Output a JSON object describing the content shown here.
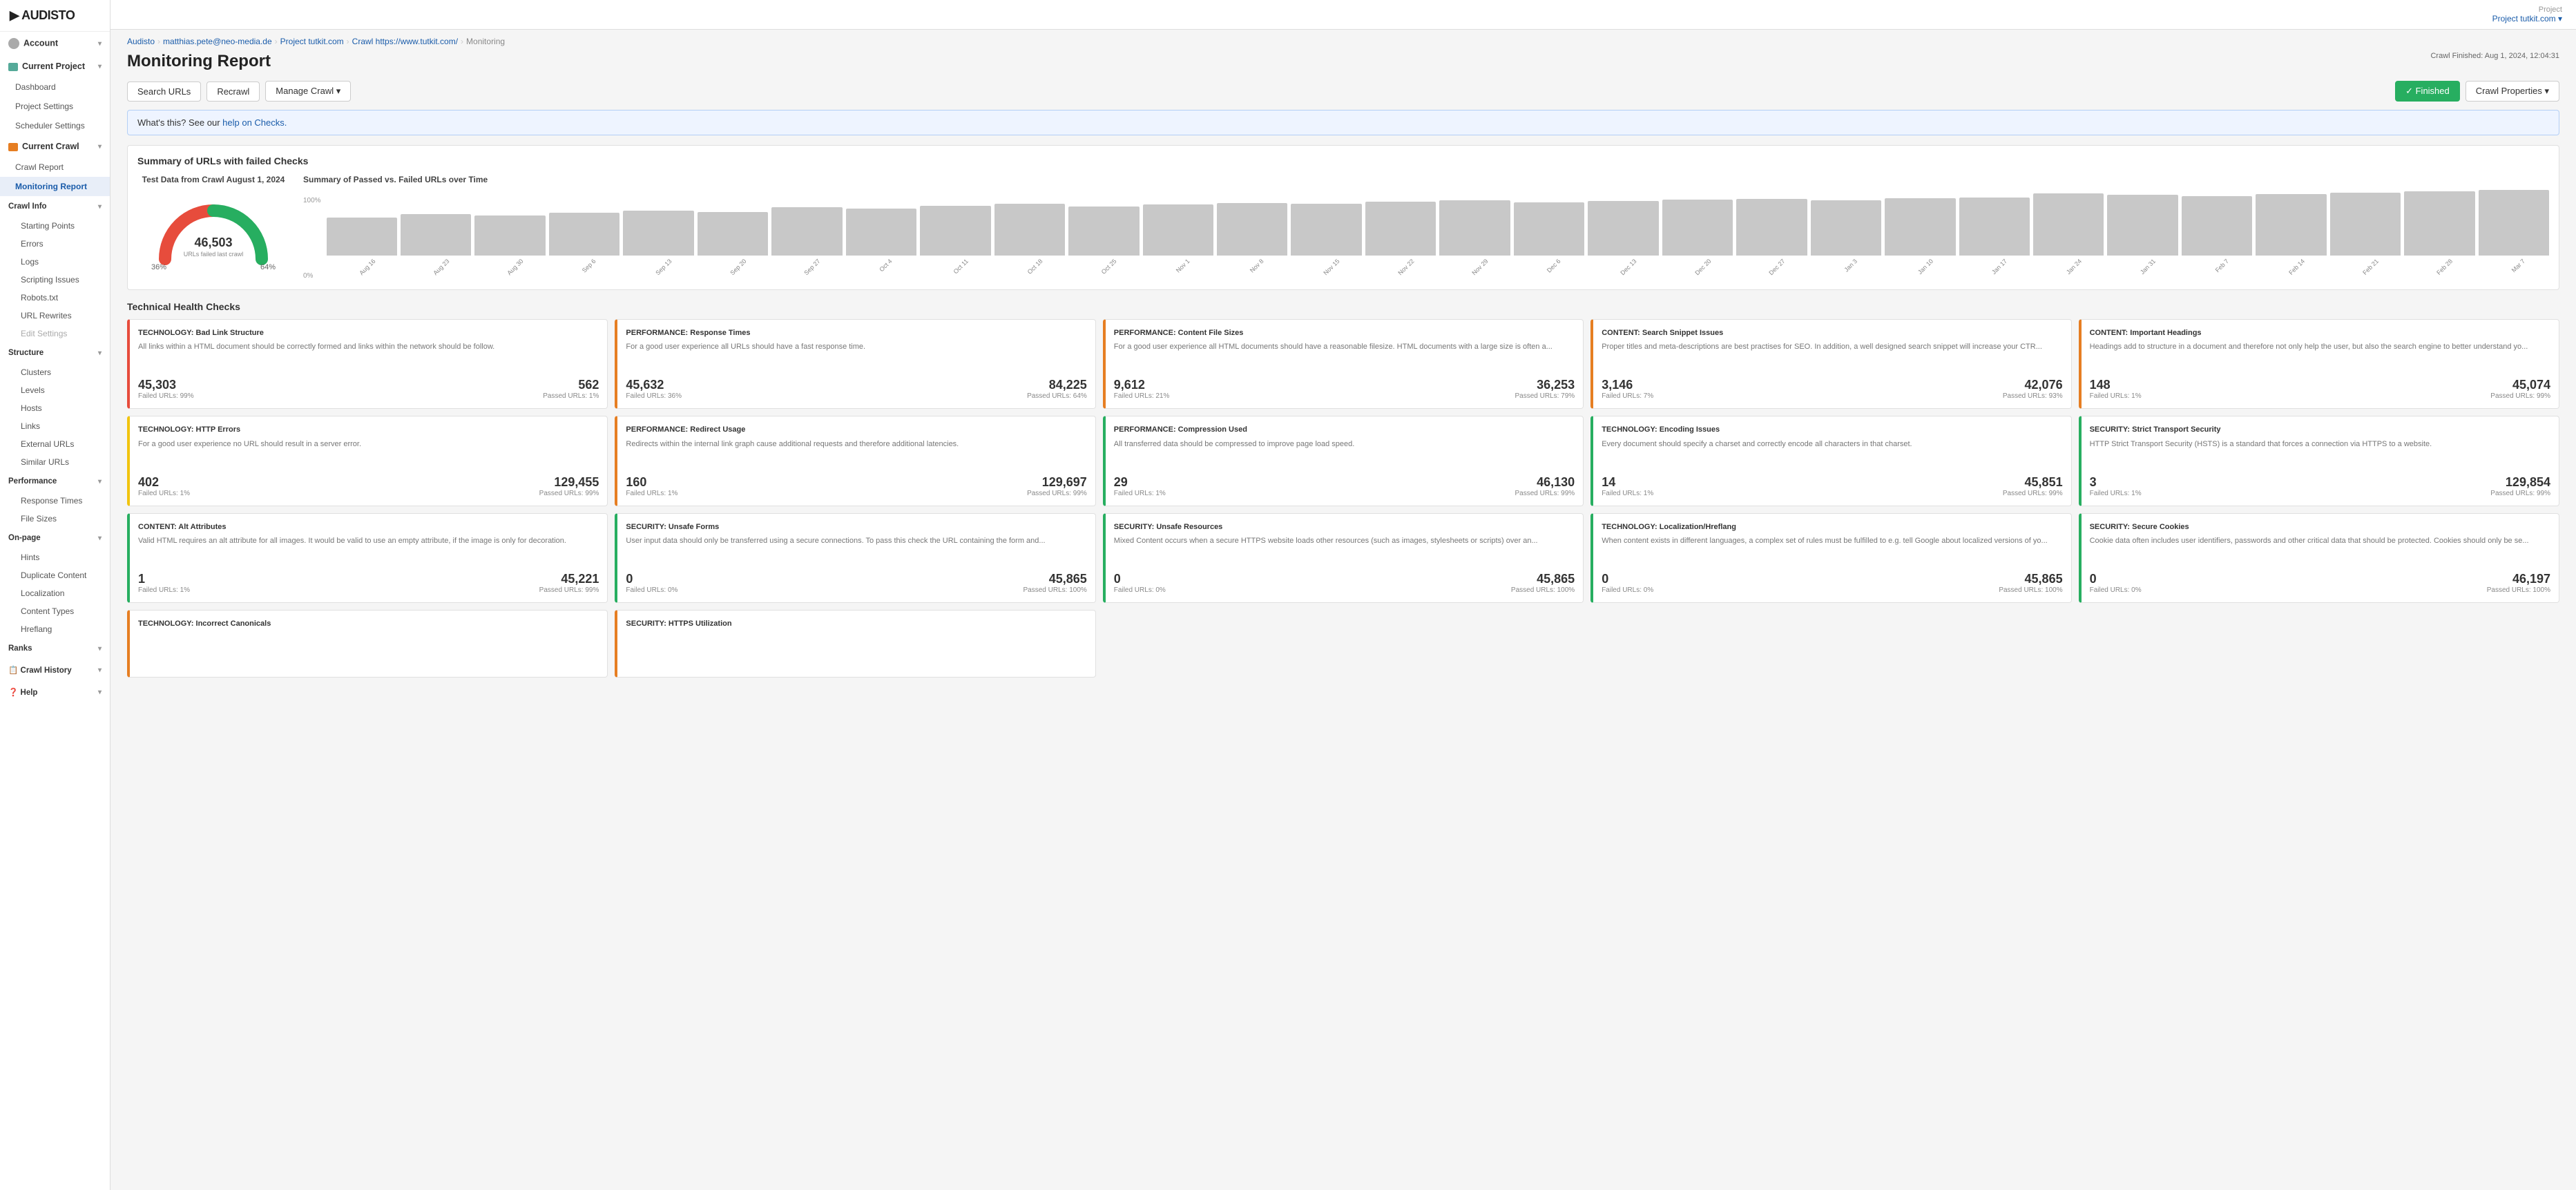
{
  "logo": {
    "text": "AUDISTO",
    "brand_color": "#e67e22"
  },
  "topbar": {
    "project_label": "Project",
    "project_name": "Project tutkit.com ▾"
  },
  "sidebar": {
    "account": {
      "label": "Account",
      "chevron": "▾"
    },
    "current_project": {
      "label": "Current Project",
      "chevron": "▾"
    },
    "current_project_items": [
      "Dashboard",
      "Project Settings",
      "Scheduler Settings"
    ],
    "current_crawl": {
      "label": "Current Crawl",
      "chevron": "▾"
    },
    "current_crawl_items": [
      "Crawl Report",
      "Monitoring Report"
    ],
    "crawl_info": {
      "label": "Crawl Info",
      "chevron": "▾"
    },
    "crawl_info_items": [
      "Starting Points",
      "Errors",
      "Logs",
      "Scripting Issues",
      "Robots.txt",
      "URL Rewrites",
      "Edit Settings"
    ],
    "structure": {
      "label": "Structure",
      "chevron": "▾"
    },
    "structure_items": [
      "Clusters",
      "Levels",
      "Hosts",
      "Links",
      "External URLs",
      "Similar URLs"
    ],
    "performance": {
      "label": "Performance",
      "chevron": "▾"
    },
    "performance_items": [
      "Response Times",
      "File Sizes"
    ],
    "on_page": {
      "label": "On-page",
      "chevron": "▾"
    },
    "on_page_items": [
      "Hints",
      "Duplicate Content",
      "Localization",
      "Content Types",
      "Hreflang"
    ],
    "ranks": {
      "label": "Ranks",
      "chevron": "▾"
    },
    "crawl_history": {
      "label": "Crawl History",
      "chevron": "▾"
    },
    "help": {
      "label": "Help",
      "chevron": "▾"
    }
  },
  "breadcrumb": {
    "items": [
      "Audisto",
      "matthias.pete@neo-media.de",
      "Project tutkit.com",
      "Crawl https://www.tutkit.com/",
      "Monitoring"
    ]
  },
  "page": {
    "title": "Monitoring Report",
    "crawl_finished": "Crawl Finished: Aug 1, 2024, 12:04:31"
  },
  "toolbar": {
    "search_urls": "Search URLs",
    "recrawl": "Recrawl",
    "manage_crawl": "Manage Crawl ▾",
    "finished_label": "✓ Finished",
    "crawl_properties": "Crawl Properties ▾"
  },
  "info_bar": {
    "text": "What's this? See our ",
    "link_text": "help on Checks.",
    "link_href": "#"
  },
  "summary": {
    "section_title": "Summary of URLs with failed Checks",
    "gauge": {
      "title": "Test Data from Crawl August 1, 2024",
      "value": "46,503",
      "label": "URLs failed last crawl",
      "pct_left": "36%",
      "pct_right": "64%",
      "failed_pct": 36,
      "passed_pct": 64
    },
    "chart": {
      "title": "Summary of Passed vs. Failed URLs over Time",
      "y_labels": [
        "100%",
        "0%"
      ],
      "bars": [
        {
          "label": "Aug 16",
          "height": 55
        },
        {
          "label": "Aug 23",
          "height": 60
        },
        {
          "label": "Aug 30",
          "height": 58
        },
        {
          "label": "Sep 6",
          "height": 62
        },
        {
          "label": "Sep 13",
          "height": 65
        },
        {
          "label": "Sep 20",
          "height": 63
        },
        {
          "label": "Sep 27",
          "height": 70
        },
        {
          "label": "Oct 4",
          "height": 68
        },
        {
          "label": "Oct 11",
          "height": 72
        },
        {
          "label": "Oct 18",
          "height": 75
        },
        {
          "label": "Oct 25",
          "height": 71
        },
        {
          "label": "Nov 1",
          "height": 74
        },
        {
          "label": "Nov 8",
          "height": 76
        },
        {
          "label": "Nov 15",
          "height": 75
        },
        {
          "label": "Nov 22",
          "height": 78
        },
        {
          "label": "Nov 29",
          "height": 80
        },
        {
          "label": "Dec 6",
          "height": 77
        },
        {
          "label": "Dec 13",
          "height": 79
        },
        {
          "label": "Dec 20",
          "height": 81
        },
        {
          "label": "Dec 27",
          "height": 82
        },
        {
          "label": "Jan 3",
          "height": 80
        },
        {
          "label": "Jan 10",
          "height": 83
        },
        {
          "label": "Jan 17",
          "height": 84
        },
        {
          "label": "Jan 24",
          "height": 90
        },
        {
          "label": "Jan 31",
          "height": 88
        },
        {
          "label": "Feb 7",
          "height": 86
        },
        {
          "label": "Feb 14",
          "height": 89
        },
        {
          "label": "Feb 21",
          "height": 91
        },
        {
          "label": "Feb 28",
          "height": 93
        },
        {
          "label": "Mar 7",
          "height": 95
        }
      ]
    }
  },
  "health_checks": {
    "section_title": "Technical Health Checks",
    "cards": [
      {
        "color": "red",
        "title": "TECHNOLOGY: Bad Link Structure",
        "desc": "All links within a HTML document should be correctly formed and links within the network should be follow.",
        "failed": "45,303",
        "passed": "562",
        "failed_pct": "Failed URLs: 99%",
        "passed_pct": "Passed URLs: 1%"
      },
      {
        "color": "orange",
        "title": "PERFORMANCE: Response Times",
        "desc": "For a good user experience all URLs should have a fast response time.",
        "failed": "45,632",
        "passed": "84,225",
        "failed_pct": "Failed URLs: 36%",
        "passed_pct": "Passed URLs: 64%"
      },
      {
        "color": "orange",
        "title": "PERFORMANCE: Content File Sizes",
        "desc": "For a good user experience all HTML documents should have a reasonable filesize. HTML documents with a large size is often a...",
        "failed": "9,612",
        "passed": "36,253",
        "failed_pct": "Failed URLs: 21%",
        "passed_pct": "Passed URLs: 79%"
      },
      {
        "color": "orange",
        "title": "CONTENT: Search Snippet Issues",
        "desc": "Proper titles and meta-descriptions are best practises for SEO. In addition, a well designed search snippet will increase your CTR...",
        "failed": "3,146",
        "passed": "42,076",
        "failed_pct": "Failed URLs: 7%",
        "passed_pct": "Passed URLs: 93%"
      },
      {
        "color": "orange",
        "title": "CONTENT: Important Headings",
        "desc": "Headings add to structure in a document and therefore not only help the user, but also the search engine to better understand yo...",
        "failed": "148",
        "passed": "45,074",
        "failed_pct": "Failed URLs: 1%",
        "passed_pct": "Passed URLs: 99%"
      },
      {
        "color": "yellow",
        "title": "TECHNOLOGY: HTTP Errors",
        "desc": "For a good user experience no URL should result in a server error.",
        "failed": "402",
        "passed": "129,455",
        "failed_pct": "Failed URLs: 1%",
        "passed_pct": "Passed URLs: 99%"
      },
      {
        "color": "orange",
        "title": "PERFORMANCE: Redirect Usage",
        "desc": "Redirects within the internal link graph cause additional requests and therefore additional latencies.",
        "failed": "160",
        "passed": "129,697",
        "failed_pct": "Failed URLs: 1%",
        "passed_pct": "Passed URLs: 99%"
      },
      {
        "color": "green",
        "title": "PERFORMANCE: Compression Used",
        "desc": "All transferred data should be compressed to improve page load speed.",
        "failed": "29",
        "passed": "46,130",
        "failed_pct": "Failed URLs: 1%",
        "passed_pct": "Passed URLs: 99%"
      },
      {
        "color": "green",
        "title": "TECHNOLOGY: Encoding Issues",
        "desc": "Every document should specify a charset and correctly encode all characters in that charset.",
        "failed": "14",
        "passed": "45,851",
        "failed_pct": "Failed URLs: 1%",
        "passed_pct": "Passed URLs: 99%"
      },
      {
        "color": "green",
        "title": "SECURITY: Strict Transport Security",
        "desc": "HTTP Strict Transport Security (HSTS) is a standard that forces a connection via HTTPS to a website.",
        "failed": "3",
        "passed": "129,854",
        "failed_pct": "Failed URLs: 1%",
        "passed_pct": "Passed URLs: 99%"
      },
      {
        "color": "green",
        "title": "CONTENT: Alt Attributes",
        "desc": "Valid HTML requires an alt attribute for all images. It would be valid to use an empty attribute, if the image is only for decoration.",
        "failed": "1",
        "passed": "45,221",
        "failed_pct": "Failed URLs: 1%",
        "passed_pct": "Passed URLs: 99%"
      },
      {
        "color": "green",
        "title": "SECURITY: Unsafe Forms",
        "desc": "User input data should only be transferred using a secure connections. To pass this check the URL containing the form and...",
        "failed": "0",
        "passed": "45,865",
        "failed_pct": "Failed URLs: 0%",
        "passed_pct": "Passed URLs: 100%"
      },
      {
        "color": "green",
        "title": "SECURITY: Unsafe Resources",
        "desc": "Mixed Content occurs when a secure HTTPS website loads other resources (such as images, stylesheets or scripts) over an...",
        "failed": "0",
        "passed": "45,865",
        "failed_pct": "Failed URLs: 0%",
        "passed_pct": "Passed URLs: 100%"
      },
      {
        "color": "green",
        "title": "TECHNOLOGY: Localization/Hreflang",
        "desc": "When content exists in different languages, a complex set of rules must be fulfilled to e.g. tell Google about localized versions of yo...",
        "failed": "0",
        "passed": "45,865",
        "failed_pct": "Failed URLs: 0%",
        "passed_pct": "Passed URLs: 100%"
      },
      {
        "color": "green",
        "title": "SECURITY: Secure Cookies",
        "desc": "Cookie data often includes user identifiers, passwords and other critical data that should be protected. Cookies should only be se...",
        "failed": "0",
        "passed": "46,197",
        "failed_pct": "Failed URLs: 0%",
        "passed_pct": "Passed URLs: 100%"
      },
      {
        "color": "orange",
        "title": "TECHNOLOGY: Incorrect Canonicals",
        "desc": "",
        "failed": "",
        "passed": "",
        "failed_pct": "",
        "passed_pct": ""
      },
      {
        "color": "orange",
        "title": "SECURITY: HTTPS Utilization",
        "desc": "",
        "failed": "",
        "passed": "",
        "failed_pct": "",
        "passed_pct": ""
      }
    ]
  }
}
